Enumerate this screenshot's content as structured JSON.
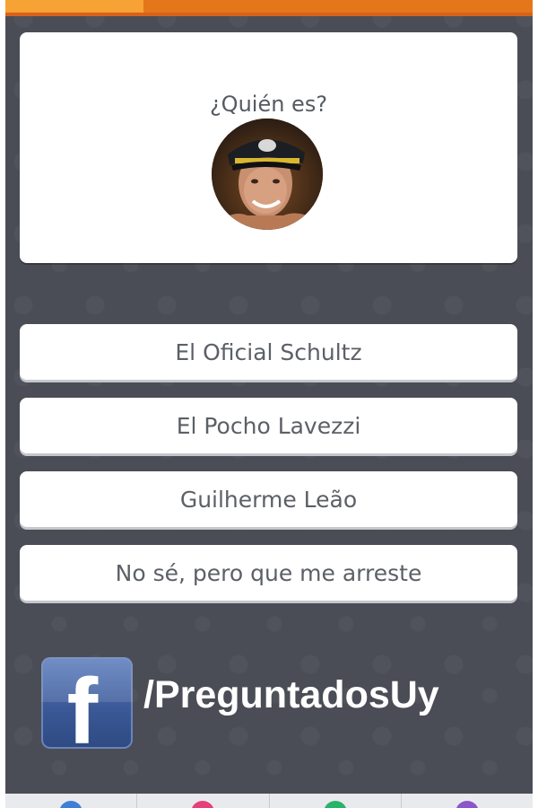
{
  "question": {
    "text": "¿Quién es?"
  },
  "answers": [
    {
      "label": "El Oficial Schultz"
    },
    {
      "label": "El Pocho Lavezzi"
    },
    {
      "label": "Guilherme Leão"
    },
    {
      "label": "No sé, pero que me arreste"
    }
  ],
  "facebook": {
    "logo_letter": "f",
    "handle": "/PreguntadosUy"
  },
  "bottom_nav": [
    {
      "icon": "blue-category-icon",
      "color": "#3f7fd6"
    },
    {
      "icon": "pink-category-icon",
      "color": "#e4407a"
    },
    {
      "icon": "green-category-icon",
      "color": "#28b36a"
    },
    {
      "icon": "purple-category-icon",
      "color": "#8a56c9"
    }
  ],
  "colors": {
    "accent_orange": "#f28a1b",
    "background": "#4a4d55",
    "facebook_blue": "#3b5998"
  }
}
